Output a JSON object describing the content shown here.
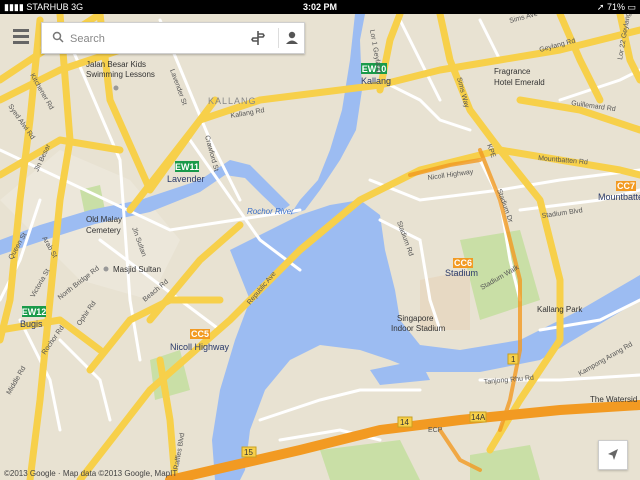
{
  "status_bar": {
    "carrier": "STARHUB",
    "network": "3G",
    "time": "3:02 PM",
    "battery": "71%"
  },
  "search": {
    "placeholder": "Search"
  },
  "attribution": "©2013 Google · Map data ©2013 Google, MapIT",
  "districts": {
    "kallang": "KALLANG"
  },
  "mrt": {
    "ew10": "EW10",
    "ew11": "EW11",
    "ew12": "EW12",
    "cc5": "CC5",
    "cc6": "CC6",
    "cc7": "CC7"
  },
  "stations": {
    "kallang": "Kallang",
    "lavender": "Lavender",
    "bugis": "Bugis",
    "nicoll_highway": "Nicoll Highway",
    "stadium": "Stadium",
    "mountbatten": "Mountbatten"
  },
  "places": {
    "jalan_besar_1": "Jalan Besar Kids",
    "jalan_besar_2": "Swimming Lessons",
    "fragrance_1": "Fragrance",
    "fragrance_2": "Hotel Emerald",
    "old_malay_1": "Old Malay",
    "old_malay_2": "Cemetery",
    "masjid": "Masjid Sultan",
    "indoor_1": "Singapore",
    "indoor_2": "Indoor Stadium",
    "kallang_park": "Kallang Park",
    "watersid": "The Watersid"
  },
  "water": {
    "rochor_river": "Rochor River"
  },
  "roads": {
    "kallang_rd": "Kallang Rd",
    "nicoll_hwy": "Nicoll Highway",
    "lavender_st": "Lavender St",
    "crawford_st": "Crawford St",
    "jln_besar": "Jln Besar",
    "kitchener_rd": "Kitchener Rd",
    "syed_alwi_rd": "Syed Alwi Rd",
    "arab_st": "Arab St",
    "jln_sultan": "Jln Sultan",
    "beach_rd": "Beach Rd",
    "north_bridge_rd": "North Bridge Rd",
    "queen_st": "Queen St",
    "victoria_st": "Victoria St",
    "ophir_rd": "Ophir Rd",
    "rochor_rd": "Rochor Rd",
    "middle_rd": "Middle Rd",
    "republic_ave": "Republic Ave",
    "raffles_blvd": "Raffles Blvd",
    "stadium_rd": "Stadium Rd",
    "stadium_dr": "Stadium Dr",
    "stadium_walk": "Stadium Walk",
    "stadium_blvd": "Stadium Blvd",
    "kpe": "KPE",
    "mountbatten_rd": "Mountbatten Rd",
    "guillemard_rd": "Guillemard Rd",
    "geylang_rd": "Geylang Rd",
    "sims_ave": "Sims Ave",
    "sims_way": "Sims Way",
    "lor1_geylang": "Lor 1 Geylang",
    "lor22_geylang": "Lor 22 Geylang",
    "tanjong_rhu": "Tanjong Rhu Rd",
    "kampong_arang": "Kampong Arang Rd",
    "ecp": "ECP"
  },
  "shields": {
    "s14": "14",
    "s14a": "14A",
    "s15": "15",
    "s1": "1"
  }
}
